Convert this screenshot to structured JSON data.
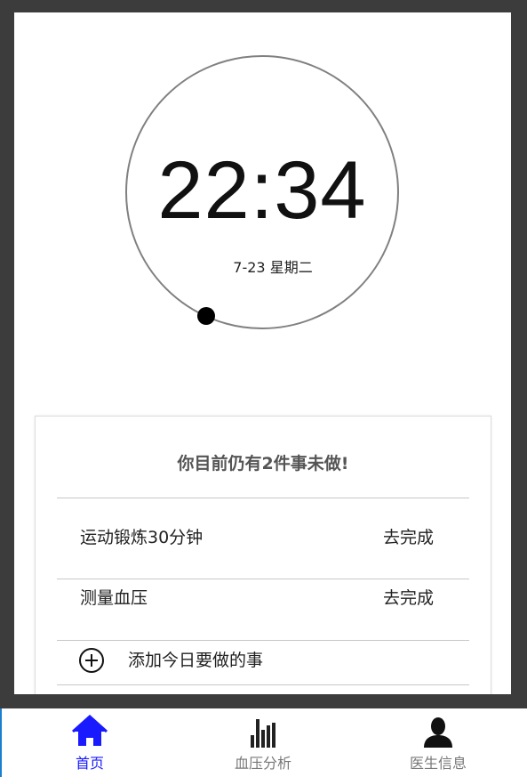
{
  "clock": {
    "time": "22:34",
    "date": "7-23 星期二"
  },
  "tasks_card": {
    "title": "你目前仍有2件事未做!",
    "items": [
      {
        "label": "运动锻炼30分钟",
        "action": "去完成"
      },
      {
        "label": "测量血压",
        "action": "去完成"
      }
    ],
    "add_label": "添加今日要做的事",
    "add_icon": "plus-circle-icon"
  },
  "bottom_nav": {
    "active_color": "#1a1aff",
    "inactive_color": "#777777",
    "items": [
      {
        "label": "首页",
        "icon": "home-icon",
        "active": true
      },
      {
        "label": "血压分析",
        "icon": "bar-chart-icon",
        "active": false
      },
      {
        "label": "医生信息",
        "icon": "person-icon",
        "active": false
      }
    ]
  }
}
